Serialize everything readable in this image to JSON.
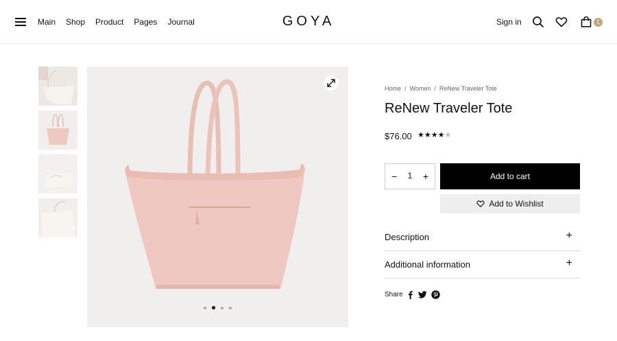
{
  "header": {
    "nav": [
      "Main",
      "Shop",
      "Product",
      "Pages",
      "Journal"
    ],
    "logo": "GOYA",
    "sign_in": "Sign in",
    "cart_count": "1",
    "icons": [
      "menu-icon",
      "search-icon",
      "heart-icon",
      "bag-icon"
    ]
  },
  "gallery": {
    "thumbnail_count": 4,
    "active_thumbnail": 2,
    "carousel_dots": 4,
    "active_dot": 2
  },
  "product": {
    "breadcrumb": [
      "Home",
      "Women",
      "ReNew Traveler Tote"
    ],
    "title": "ReNew Traveler Tote",
    "price": "$76.00",
    "rating": 4,
    "rating_max": 5,
    "quantity": "1",
    "add_to_cart": "Add to cart",
    "wishlist": "Add to Wishlist",
    "accordions": [
      "Description",
      "Additional information"
    ],
    "share_label": "Share",
    "share_icons": [
      "facebook-icon",
      "twitter-icon",
      "pinterest-icon"
    ]
  },
  "colors": {
    "accent": "#c4a77d",
    "button": "#000000",
    "bag": "#efc9c1"
  }
}
